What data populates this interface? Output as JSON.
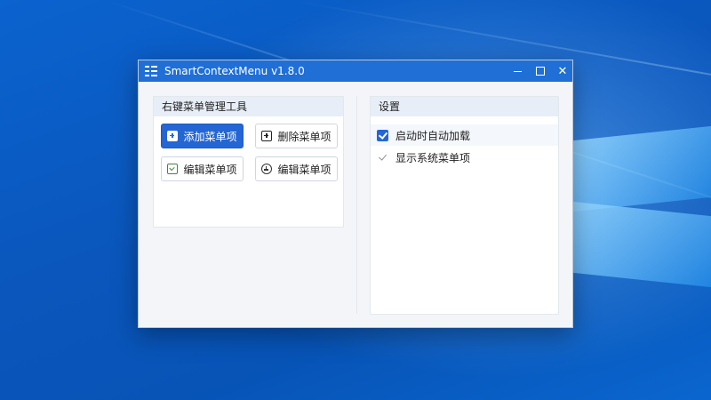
{
  "window": {
    "title": "SmartContextMenu v1.8.0"
  },
  "left_panel": {
    "title": "右键菜单管理工具",
    "buttons": [
      {
        "label": "添加菜单项",
        "icon": "plus-box-icon"
      },
      {
        "label": "删除菜单项",
        "icon": "plus-box-icon"
      },
      {
        "label": "编辑菜单项",
        "icon": "edit-icon"
      },
      {
        "label": "编辑菜单项",
        "icon": "circle-icon"
      }
    ]
  },
  "settings": {
    "title": "设置",
    "options": [
      {
        "label": "启动时自动加载",
        "checked": true
      },
      {
        "label": "显示系统菜单项",
        "checked": true
      }
    ]
  },
  "colors": {
    "accent": "#2366d4",
    "titlebar": "#1f6fd6"
  }
}
